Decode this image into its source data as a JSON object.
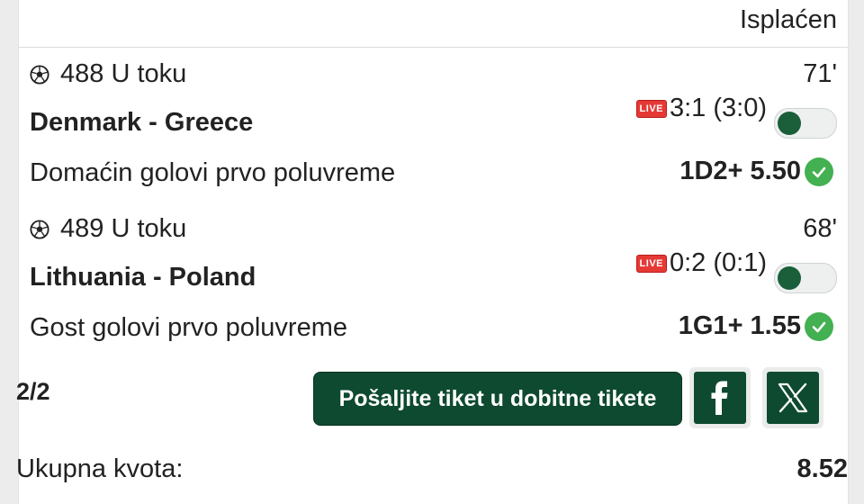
{
  "ticket": {
    "status": "Isplaćen",
    "count": "2/2",
    "send_button": "Pošaljite tiket u dobitne tikete",
    "total_label": "Ukupna kvota:",
    "total_value": "8.52"
  },
  "events": [
    {
      "header": "488 U toku",
      "minute": "71'",
      "teams": "Denmark - Greece",
      "live_label": "LIVE",
      "score": "3:1 (3:0)",
      "market": "Domaćin golovi prvo poluvreme",
      "odd": "1D2+ 5.50",
      "toggle_on": false
    },
    {
      "header": "489 U toku",
      "minute": "68'",
      "teams": "Lithuania - Poland",
      "live_label": "LIVE",
      "score": "0:2 (0:1)",
      "market": "Gost golovi prvo poluvreme",
      "odd": "1G1+ 1.55",
      "toggle_on": false
    }
  ],
  "icons": {
    "ball": "soccer-ball-icon",
    "check": "check-icon",
    "facebook": "facebook-icon",
    "x": "x-icon"
  },
  "colors": {
    "brand_green": "#0e4a30",
    "check_green": "#43b051",
    "live_red": "#e53935"
  }
}
